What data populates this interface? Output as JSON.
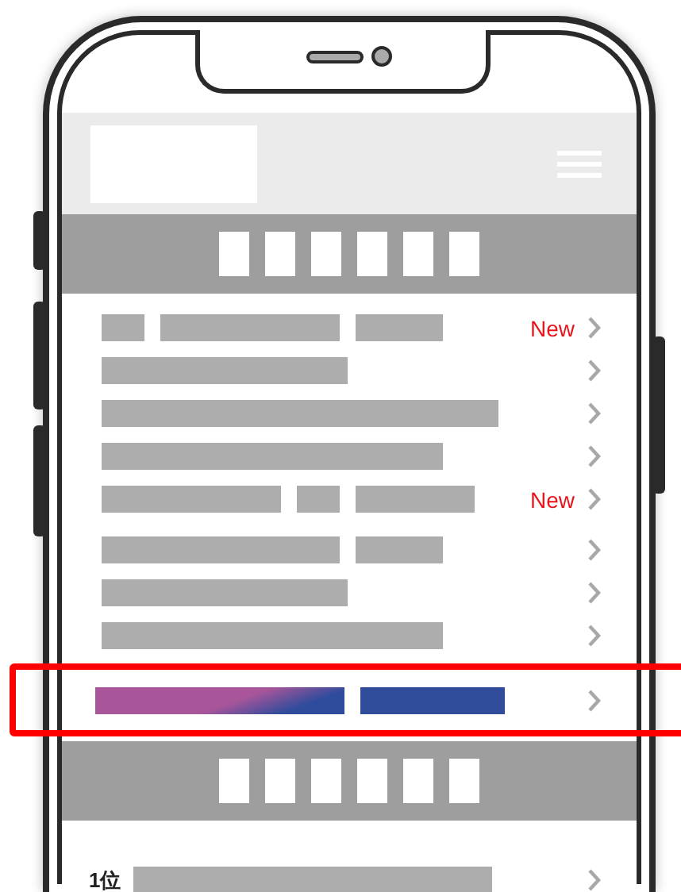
{
  "menu_rows": [
    {
      "bars": [
        {
          "kind": "tiny"
        },
        {
          "kind": "half"
        },
        {
          "kind": "short"
        }
      ],
      "badge": "New",
      "highlighted": false
    },
    {
      "bars": [
        {
          "kind": "long"
        }
      ],
      "highlighted": false
    },
    {
      "bars": [
        {
          "kind": "full"
        }
      ],
      "highlighted": false
    },
    {
      "bars": [
        {
          "kind": "longer"
        }
      ],
      "highlighted": false
    },
    {
      "bars": [
        {
          "kind": "half"
        },
        {
          "kind": "tiny"
        },
        {
          "kind": "mid"
        }
      ],
      "badge": "New",
      "highlighted": false
    },
    {
      "bars": [
        {
          "kind": "long2"
        },
        {
          "kind": "short"
        }
      ],
      "highlighted": false
    },
    {
      "bars": [
        {
          "kind": "long"
        }
      ],
      "highlighted": false
    },
    {
      "bars": [
        {
          "kind": "longer"
        }
      ],
      "highlighted": false
    },
    {
      "bars": [
        {
          "kind": "gradient"
        },
        {
          "kind": "blue"
        }
      ],
      "highlighted": true
    }
  ],
  "ranking_rows": [
    {
      "rank": "1位",
      "bars": [
        {
          "kind": "ranking"
        }
      ]
    }
  ]
}
